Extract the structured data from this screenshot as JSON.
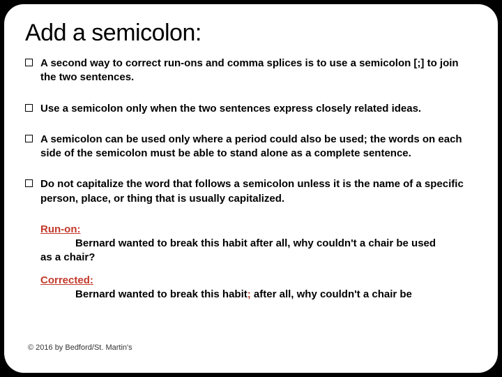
{
  "title": "Add a semicolon:",
  "bullets": [
    {
      "pre": "A second way to correct run-ons and comma splices is to use a ",
      "bold": "semicolon [;]",
      "post": " to join the two sentences."
    },
    {
      "pre": "Use a semicolon ",
      "mid1": "only",
      "between": " when the two sentences express ",
      "mid2": "closely related ideas",
      "post": "."
    },
    {
      "text": "A semicolon can be used only where a period could also be used; the words on each side of the semicolon must be able to stand alone as a complete sentence."
    },
    {
      "text": "Do not capitalize the word that follows a semicolon unless it is the name of a specific person, place, or thing that is usually capitalized."
    }
  ],
  "example": {
    "runon_label": "Run-on:",
    "runon_text_indent": "Bernard wanted to break this habit after all, why couldn't a chair be used",
    "runon_text_wrap": "as a chair?",
    "corrected_label": "Corrected:",
    "corrected_pre": "Bernard wanted to break this habit",
    "corrected_semi": ";",
    "corrected_post": " after all, why couldn't a chair be"
  },
  "copyright": "© 2016 by Bedford/St. Martin's"
}
